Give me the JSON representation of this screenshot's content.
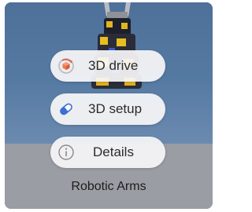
{
  "tile": {
    "caption": "Robotic Arms",
    "image": "robotic-arm-3d-model"
  },
  "context_menu": {
    "items": [
      {
        "label": "3D drive",
        "icon": "3d-drive-icon",
        "accent": "#e2574c"
      },
      {
        "label": "3D setup",
        "icon": "3d-setup-icon",
        "accent": "#3a6fd8"
      },
      {
        "label": "Details",
        "icon": "info-icon",
        "accent": "#8a8a8a"
      }
    ]
  }
}
